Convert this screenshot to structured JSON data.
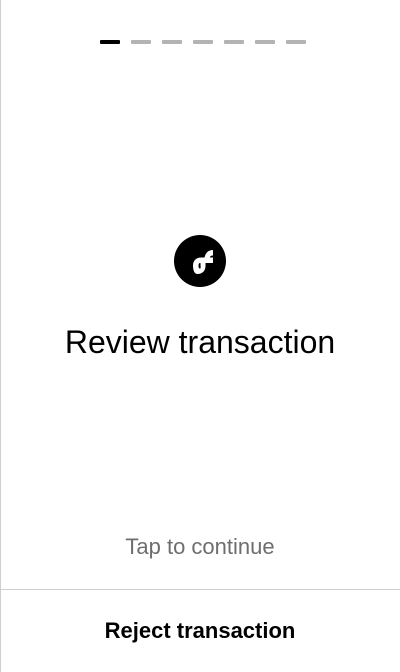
{
  "stepper": {
    "total_steps": 7,
    "current_step": 1,
    "active_color": "#000000",
    "inactive_color": "#b3b3b3"
  },
  "logo": {
    "icon": "flow-logo-icon",
    "background": "#000000"
  },
  "main": {
    "title": "Review transaction",
    "hint": "Tap to continue"
  },
  "footer": {
    "reject_label": "Reject transaction"
  }
}
